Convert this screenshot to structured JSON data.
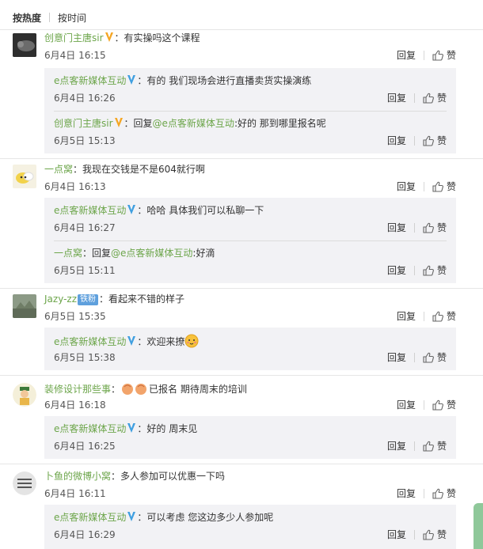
{
  "sort": {
    "hot_label": "按热度",
    "time_label": "按时间"
  },
  "actions": {
    "reply_label": "回复",
    "like_label": "赞"
  },
  "comments": [
    {
      "user": "创意门主唐sir",
      "verified": "gold",
      "text": "：有实操吗这个课程",
      "time": "6月4日 16:15",
      "replies": [
        {
          "user": "e点客新媒体互动",
          "verified": "blue",
          "text": "：有的 我们现场会进行直播卖货实操演练",
          "time": "6月4日 16:26"
        },
        {
          "user": "创意门主唐sir",
          "verified": "gold",
          "prefix": "：回复",
          "mention": "@e点客新媒体互动",
          "text": ":好的 那到哪里报名呢",
          "time": "6月5日 15:13"
        }
      ]
    },
    {
      "user": "一点窝",
      "text": "：我现在交钱是不是604就行啊",
      "time": "6月4日 16:13",
      "replies": [
        {
          "user": "e点客新媒体互动",
          "verified": "blue",
          "text": "：哈哈 具体我们可以私聊一下",
          "time": "6月4日 16:27"
        },
        {
          "user": "一点窝",
          "prefix": "：回复",
          "mention": "@e点客新媒体互动",
          "text": ":好滴",
          "time": "6月5日 15:11"
        }
      ]
    },
    {
      "user": "Jazy-zz",
      "badge": "铁粉",
      "text": "：看起来不错的样子",
      "time": "6月5日 15:35",
      "replies": [
        {
          "user": "e点客新媒体互动",
          "verified": "blue",
          "text": "：欢迎来撩",
          "time": "6月5日 15:38"
        }
      ]
    },
    {
      "user": "装修设计那些事",
      "text": "：",
      "text_after": "已报名 期待周末的培训",
      "time": "6月4日 16:18",
      "replies": [
        {
          "user": "e点客新媒体互动",
          "verified": "blue",
          "text": "：好的 周末见",
          "time": "6月4日 16:25"
        }
      ]
    },
    {
      "user": "卜鱼的微博小窝",
      "text": "：多人参加可以优惠一下吗",
      "time": "6月4日 16:11",
      "replies": [
        {
          "user": "e点客新媒体互动",
          "verified": "blue",
          "text": "：可以考虑 您这边多少人参加呢",
          "time": "6月4日 16:29"
        }
      ]
    }
  ],
  "colors": {
    "username": "#6ca54a",
    "reply_bg": "#f2f2f5",
    "fan_badge": "#5fa0dd",
    "verified_blue": "#3f9fe0",
    "verified_gold": "#f5a623"
  }
}
